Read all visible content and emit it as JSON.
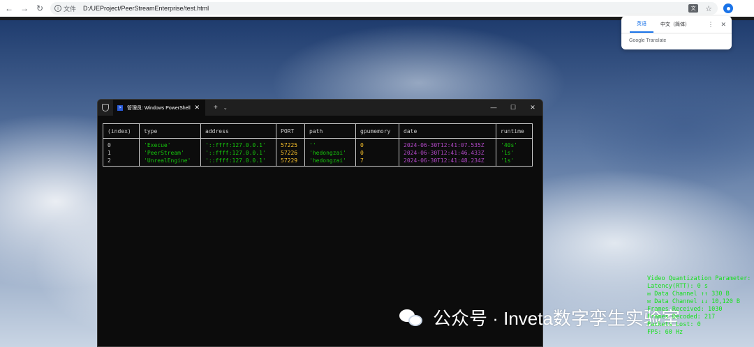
{
  "browser": {
    "file_label": "文件",
    "url": "D:/UEProject/PeerStreamEnterprise/test.html",
    "translate_icon": "translate-icon",
    "star_icon": "star-icon"
  },
  "translate_popup": {
    "tabs": [
      "英语",
      "中文（简体）"
    ],
    "footer": "Google Translate"
  },
  "terminal": {
    "tab_title": "管理员: Windows PowerShell",
    "table": {
      "headers": [
        "(index)",
        "type",
        "address",
        "PORT",
        "path",
        "gpumemory",
        "date",
        "runtime"
      ],
      "columns": {
        "index": [
          "0",
          "1",
          "2"
        ],
        "type": [
          "'Execue'",
          "'PeerStream'",
          "'UnrealEngine'"
        ],
        "address": [
          "'::ffff:127.0.0.1'",
          "'::ffff:127.0.0.1'",
          "'::ffff:127.0.0.1'"
        ],
        "port": [
          "57225",
          "57226",
          "57229"
        ],
        "path": [
          "''",
          "'hedongzai'",
          "'hedongzai'"
        ],
        "gpumemory": [
          "0",
          "0",
          "7"
        ],
        "date": [
          "2024-06-30T12:41:07.535Z",
          "2024-06-30T12:41:46.433Z",
          "2024-06-30T12:41:48.234Z"
        ],
        "runtime": [
          "'40s'",
          "'1s'",
          "'1s'"
        ]
      }
    }
  },
  "stats": {
    "lines": [
      "Video Quantization Parameter:",
      "Latency(RTT): 0 s",
      "✉ Data Channel ↑↑ 330 B",
      "✉ Data Channel ↓↓ 10,120 B",
      "Frames Received: 1030",
      "Frames Decoded: 217",
      "Packets Lost: 0",
      "FPS: 60 Hz"
    ]
  },
  "watermark": {
    "text": "公众号 · Inveta数字孪生实验室"
  },
  "colors": {
    "terminal_bg": "#0c0c0c",
    "string_green": "#16c60c",
    "number_yellow": "#f9c12b",
    "date_magenta": "#b148c6",
    "stats_green": "#16e01c"
  }
}
